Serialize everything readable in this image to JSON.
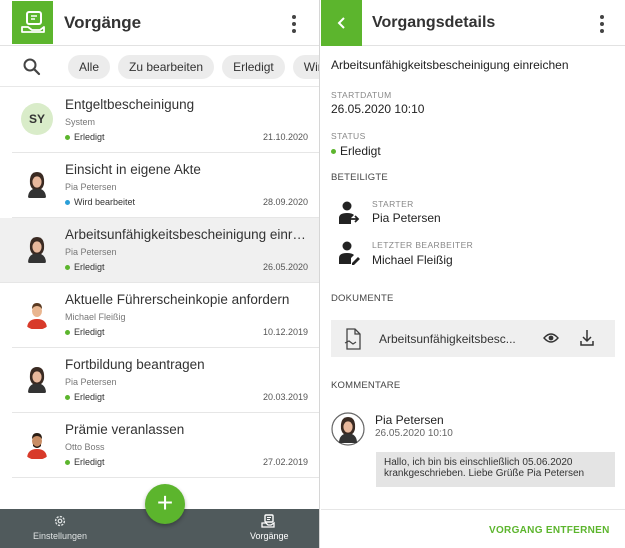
{
  "left": {
    "title": "Vorgänge",
    "filters": [
      "Alle",
      "Zu bearbeiten",
      "Erledigt",
      "Wird b"
    ],
    "items": [
      {
        "title": "Entgeltbescheinigung",
        "sub": "System",
        "status": "Erledigt",
        "status_color": "#5cb52d",
        "date": "21.10.2020",
        "avatar": "SY"
      },
      {
        "title": "Einsicht in eigene Akte",
        "sub": "Pia Petersen",
        "status": "Wird bearbeitet",
        "status_color": "#2a9fd8",
        "date": "28.09.2020",
        "avatar": "female-portrait"
      },
      {
        "title": "Arbeitsunfähigkeitsbescheinigung einreich...",
        "sub": "Pia Petersen",
        "status": "Erledigt",
        "status_color": "#5cb52d",
        "date": "26.05.2020",
        "avatar": "female-portrait"
      },
      {
        "title": "Aktuelle Führerscheinkopie anfordern",
        "sub": "Michael Fleißig",
        "status": "Erledigt",
        "status_color": "#5cb52d",
        "date": "10.12.2019",
        "avatar": "male-portrait"
      },
      {
        "title": "Fortbildung beantragen",
        "sub": "Pia Petersen",
        "status": "Erledigt",
        "status_color": "#5cb52d",
        "date": "20.03.2019",
        "avatar": "female-portrait"
      },
      {
        "title": "Prämie veranlassen",
        "sub": "Otto Boss",
        "status": "Erledigt",
        "status_color": "#5cb52d",
        "date": "27.02.2019",
        "avatar": "male-portrait"
      }
    ],
    "nav": {
      "settings": "Einstellungen",
      "processes": "Vorgänge"
    },
    "fab": "+"
  },
  "right": {
    "title": "Vorgangsdetails",
    "heading": "Arbeitsunfähigkeitsbescheinigung einreichen",
    "start_label": "STARTDATUM",
    "start_value": "26.05.2020 10:10",
    "status_label": "STATUS",
    "status_value": "Erledigt",
    "participants_label": "BETEILIGTE",
    "starter_label": "STARTER",
    "starter_value": "Pia Petersen",
    "last_editor_label": "LETZTER BEARBEITER",
    "last_editor_value": "Michael Fleißig",
    "documents_label": "DOKUMENTE",
    "document_name": "Arbeitsunfähigkeitsbesc...",
    "comments_label": "KOMMENTARE",
    "comment_author": "Pia Petersen",
    "comment_date": "26.05.2020 10:10",
    "comment_text": "Hallo, ich bin bis einschließlich 05.06.2020 krankgeschrieben. Liebe Grüße Pia Petersen",
    "remove_button": "VORGANG ENTFERNEN"
  },
  "colors": {
    "accent": "#5cb52d",
    "nav_bg": "#505a5c",
    "in_progress": "#2a9fd8"
  }
}
